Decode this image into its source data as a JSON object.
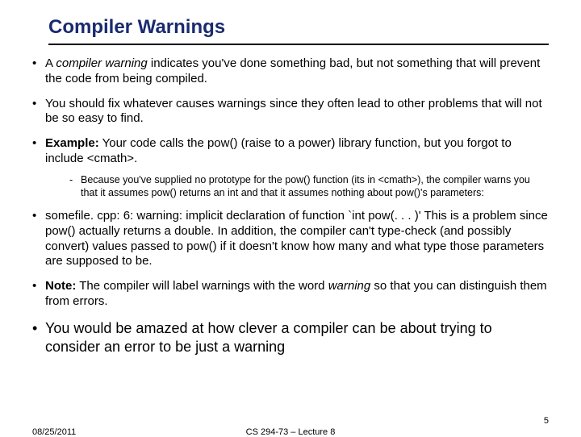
{
  "title": "Compiler Warnings",
  "bullets": {
    "b1_pre": "A ",
    "b1_em": "compiler warning",
    "b1_post": " indicates you've done something bad, but not something that will prevent the code from being compiled.",
    "b2": "You should fix whatever causes warnings since they often lead to other problems that will not be so easy to find.",
    "b3_strong": "Example:",
    "b3_rest": " Your code calls the pow() (raise to a power) library function, but you forgot to include <cmath>.",
    "b3_sub": "Because you've supplied no prototype for the pow() function (its in <cmath>), the compiler warns you that it assumes pow() returns an int and that it assumes nothing about pow()'s parameters:",
    "b4": "somefile. cpp: 6: warning: implicit declaration of function `int pow(. . . )'  This is a problem since pow() actually returns a double. In addition, the compiler can't type-check (and possibly convert) values passed to pow() if it doesn't know how many and what type those parameters are supposed to be.",
    "b5_strong": "Note:",
    "b5_mid": " The compiler will label warnings with the word ",
    "b5_em": "warning",
    "b5_post": " so that you can distinguish them from errors.",
    "b6": "You would be amazed at how clever a compiler can be about trying to consider an error to be just a warning"
  },
  "footer": {
    "date": "08/25/2011",
    "center": "CS 294-73 – Lecture 8",
    "page": "5"
  }
}
